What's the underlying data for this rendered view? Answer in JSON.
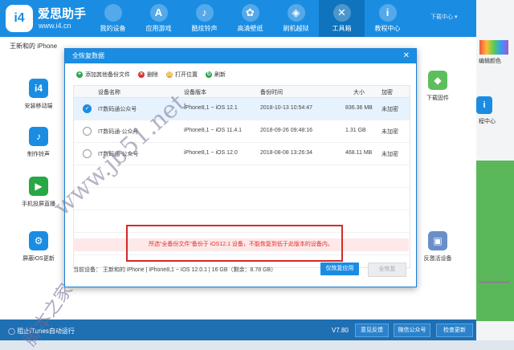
{
  "header": {
    "logo_text": "i4",
    "brand": "爱思助手",
    "url": "www.i4.cn",
    "nav": [
      {
        "icon": "apple-icon",
        "glyph": "",
        "label": "我的设备"
      },
      {
        "icon": "app-store-icon",
        "glyph": "A",
        "label": "应用游戏"
      },
      {
        "icon": "bell-icon",
        "glyph": "♪",
        "label": "酷炫铃声"
      },
      {
        "icon": "flower-icon",
        "glyph": "✿",
        "label": "高清壁纸"
      },
      {
        "icon": "dropbox-icon",
        "glyph": "◈",
        "label": "刷机越狱"
      },
      {
        "icon": "tools-icon",
        "glyph": "✕",
        "label": "工具箱"
      },
      {
        "icon": "info-icon",
        "glyph": "i",
        "label": "教程中心"
      }
    ],
    "download_center": "下载中心 ▾"
  },
  "device_bar": {
    "name": "王新和的 iPhone"
  },
  "tools": [
    {
      "label": "安装移动端",
      "glyph": "i4",
      "color": "#1a8de3"
    },
    {
      "label": "制作铃声",
      "glyph": "♪",
      "color": "#1a8de3"
    },
    {
      "label": "手机投屏直播",
      "glyph": "▶",
      "color": "#28a745"
    },
    {
      "label": "屏蔽iOS更新",
      "glyph": "⚙",
      "color": "#1a8de3"
    },
    {
      "label": "下载固件",
      "glyph": "◆",
      "color": "#5cbf5c"
    },
    {
      "label": "反激活设备",
      "glyph": "▣",
      "color": "#6a8fc8"
    }
  ],
  "right_panel": {
    "label1": "编辑颜色",
    "label2": "程中心"
  },
  "dialog": {
    "title": "全恢复数据",
    "toolbar": [
      {
        "label": "添加其他备份文件",
        "icon": "add-icon",
        "glyph": "+",
        "color": "#28a745"
      },
      {
        "label": "删除",
        "icon": "delete-icon",
        "glyph": "×",
        "color": "#e03030"
      },
      {
        "label": "打开位置",
        "icon": "folder-icon",
        "glyph": "▤",
        "color": "#e0a020"
      },
      {
        "label": "刷新",
        "icon": "refresh-icon",
        "glyph": "↻",
        "color": "#28a745"
      }
    ],
    "columns": [
      "设备名称",
      "设备版本",
      "备份时间",
      "大小",
      "加密"
    ],
    "rows": [
      {
        "name": "IT数码通公众号",
        "version": "iPhone8,1 ~ iOS 12.1",
        "time": "2018-10-13 10:54:47",
        "size": "836.36 MB",
        "enc": "未加密",
        "selected": true
      },
      {
        "name": "IT数码通-公众号",
        "version": "iPhone8,1 ~ iOS 11.4.1",
        "time": "2018-09-26 09:48:16",
        "size": "1.31 GB",
        "enc": "未加密",
        "selected": false
      },
      {
        "name": "IT数码通-公众号",
        "version": "iPhone8,1 ~ iOS 12.0",
        "time": "2018-08-08 13:26:34",
        "size": "468.11 MB",
        "enc": "未加密",
        "selected": false
      }
    ],
    "warning": "所选“全备份文件”备份于 iOS12.1 设备，不能恢复到低于此版本的设备内。",
    "footer_info": "当前设备：  王新和的 iPhone  |  iPhone8,1 ~ iOS 12.0.1  |  16 GB（剩余：8.78 GB）",
    "btn_restore": "仅恢复应用",
    "btn_all": "全恢复"
  },
  "footer": {
    "itunes": "阻止iTunes自动运行",
    "version": "V7.80",
    "feedback": "意见反馈",
    "wechat": "微信公众号",
    "update": "检查更新"
  },
  "watermark": {
    "line1": "www.jb51.net",
    "line2": "脚本之家"
  }
}
